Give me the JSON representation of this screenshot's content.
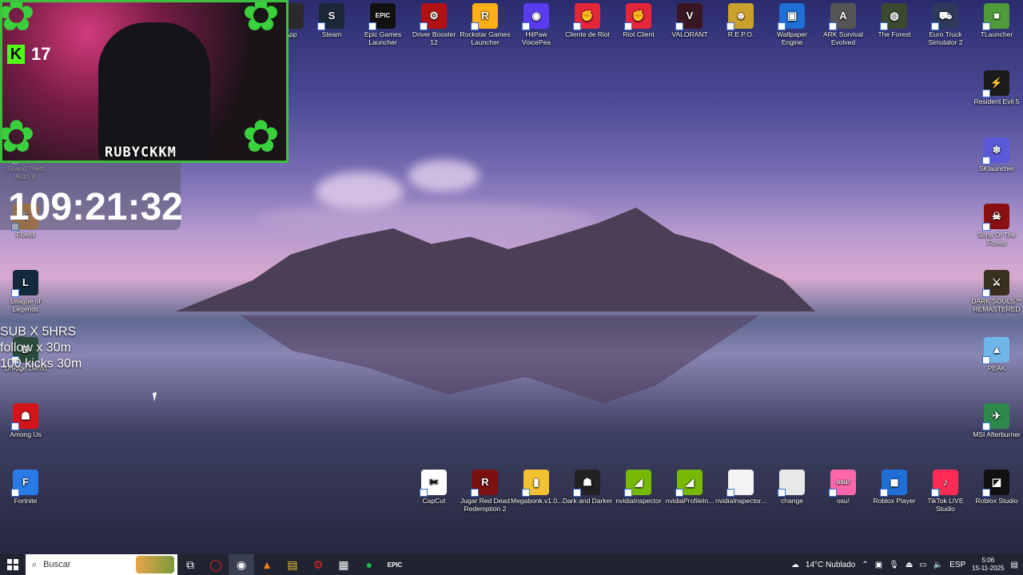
{
  "overlay": {
    "kick_count": "17",
    "streamer": "RUBYCKKM",
    "timer": "109:21:32",
    "goals": [
      "SUB X 5HRS",
      "follow x 30m",
      "100 kicks 30m"
    ]
  },
  "desktop_icons_top": [
    {
      "label": "App",
      "color": "#2a2a2a",
      "glyph": ""
    },
    {
      "label": "Steam",
      "color": "#1b2838",
      "glyph": "S"
    },
    {
      "label": "Epic Games Launcher",
      "color": "#111",
      "glyph": "EPIC"
    },
    {
      "label": "Driver Booster 12",
      "color": "#b31212",
      "glyph": "⚙"
    },
    {
      "label": "Rockstar Games Launcher",
      "color": "#fcaf17",
      "glyph": "R"
    },
    {
      "label": "HitPaw VoicePea",
      "color": "#5a3cf0",
      "glyph": "◉"
    },
    {
      "label": "Cliente de Riot",
      "color": "#e8263a",
      "glyph": "✊"
    },
    {
      "label": "Riot Client",
      "color": "#e8263a",
      "glyph": "✊"
    },
    {
      "label": "VALORANT",
      "color": "#3a1622",
      "glyph": "V"
    },
    {
      "label": "R.E.P.O.",
      "color": "#c9a12b",
      "glyph": "☻"
    },
    {
      "label": "Wallpaper Engine",
      "color": "#1f6fd6",
      "glyph": "▣"
    },
    {
      "label": "ARK Survival Evolved",
      "color": "#555",
      "glyph": "A"
    },
    {
      "label": "The Forest",
      "color": "#3a4a30",
      "glyph": "◍"
    },
    {
      "label": "Euro Truck Simulator 2",
      "color": "#2d3a5a",
      "glyph": "⛟"
    },
    {
      "label": "TLauncher",
      "color": "#4f9a3a",
      "glyph": "■"
    }
  ],
  "desktop_icons_right": [
    {
      "label": "Resident Evil 5",
      "color": "#1b1b1b",
      "glyph": "⚡"
    },
    {
      "label": "SKlauncher",
      "color": "#5a5ad8",
      "glyph": "❄"
    },
    {
      "label": "Sons Of The Forest",
      "color": "#8a1010",
      "glyph": "☠"
    },
    {
      "label": "DARK SOULS™ REMASTERED",
      "color": "#3a3020",
      "glyph": "⚔"
    },
    {
      "label": "PEAK",
      "color": "#6fb6e8",
      "glyph": "▲"
    },
    {
      "label": "MSI Afterburner",
      "color": "#2d8a4a",
      "glyph": "✈"
    }
  ],
  "desktop_icons_left": [
    {
      "label": "Grand Theft Auto V",
      "color": "transparent",
      "glyph": ""
    },
    {
      "label": "FiveM",
      "color": "#e58a1c",
      "glyph": "5"
    },
    {
      "label": "League of Legends",
      "color": "#122a3a",
      "glyph": "L"
    },
    {
      "label": "Dredge Demo",
      "color": "#2a4a3a",
      "glyph": "D"
    },
    {
      "label": "Among Us",
      "color": "#d3151a",
      "glyph": "☗"
    },
    {
      "label": "Fortnite",
      "color": "#2a7ae8",
      "glyph": "F"
    }
  ],
  "desktop_icons_bottom": [
    {
      "label": "CapCut",
      "color": "#fff",
      "glyph": "✂"
    },
    {
      "label": "Jugar Red Dead Redemption 2",
      "color": "#7a1010",
      "glyph": "R"
    },
    {
      "label": "Megabonk.v1.0...",
      "color": "#f3c233",
      "glyph": "▮"
    },
    {
      "label": "Dark and Darker",
      "color": "#222",
      "glyph": "☗"
    },
    {
      "label": "nvidiaInspector",
      "color": "#76b900",
      "glyph": "◢"
    },
    {
      "label": "nvidiaProfileIn...",
      "color": "#76b900",
      "glyph": "◢"
    },
    {
      "label": "nvidiaInspector...",
      "color": "#f3f3f3",
      "glyph": ""
    },
    {
      "label": "change",
      "color": "#e8e8e8",
      "glyph": ""
    },
    {
      "label": "osu!",
      "color": "#ff66aa",
      "glyph": "osu!"
    },
    {
      "label": "Roblox Player",
      "color": "#1f6fd6",
      "glyph": "◼"
    },
    {
      "label": "TikTok LIVE Studio",
      "color": "#fe2c55",
      "glyph": "♪"
    },
    {
      "label": "Roblox Studio",
      "color": "#111",
      "glyph": "◪"
    }
  ],
  "taskbar": {
    "search_placeholder": "Buscar",
    "weather": "14°C  Nublado",
    "language": "ESP",
    "time": "5:06",
    "date": "15-11-2025"
  }
}
